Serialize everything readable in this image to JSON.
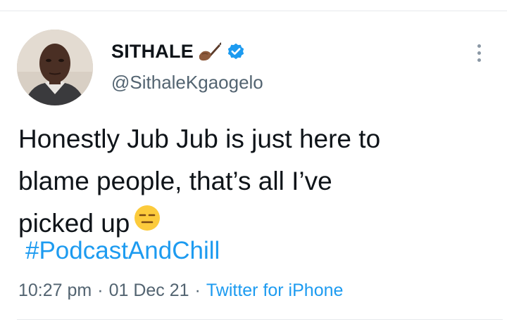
{
  "author": {
    "display_name": "SITHALE",
    "handle": "@SithaleKgaogelo",
    "verified": true,
    "name_emoji": "writing-hand-icon"
  },
  "tweet": {
    "lines": [
      "Honestly Jub Jub is just here to",
      "blame people, that’s all I’ve",
      "picked up"
    ],
    "emoji": "expressionless-face-icon",
    "hashtag": "#PodcastAndChill"
  },
  "meta": {
    "time": "10:27 pm",
    "date": "01 Dec 21",
    "separator": "·",
    "source": "Twitter for iPhone"
  },
  "colors": {
    "link": "#1d9bf0",
    "secondary_text": "#536471",
    "primary_text": "#0f1419",
    "divider": "#e6e9ec"
  }
}
